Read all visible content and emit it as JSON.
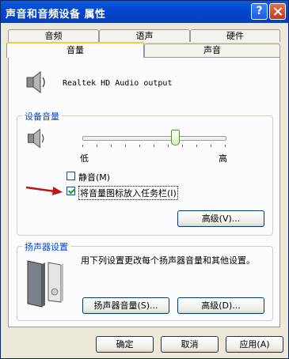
{
  "window": {
    "title": "声音和音频设备 属性"
  },
  "titlebar_buttons": {
    "help": "?"
  },
  "tabs_row1": [
    "音频",
    "语声",
    "硬件"
  ],
  "tabs_row2": [
    "音量",
    "声音"
  ],
  "device": {
    "name": "Realtek HD Audio output"
  },
  "device_volume": {
    "title": "设备音量",
    "slider_min_label": "低",
    "slider_max_label": "高",
    "slider_level_percent": 65,
    "mute_label": "静音(M)",
    "mute_checked": false,
    "tray_label": "将音量图标放入任务栏(I)",
    "tray_checked": true,
    "advanced_button": "高级(V)..."
  },
  "speaker_settings": {
    "title": "扬声器设置",
    "description": "用下列设置更改每个扬声器音量和其他设置。",
    "speaker_volume_button": "扬声器音量(S)...",
    "advanced_button": "高级(D)..."
  },
  "footer": {
    "ok": "确定",
    "cancel": "取消",
    "apply": "应用(A)"
  },
  "colors": {
    "titlebar": "#0146d1",
    "group_title": "#0046d5",
    "arrow": "#c0141a"
  }
}
